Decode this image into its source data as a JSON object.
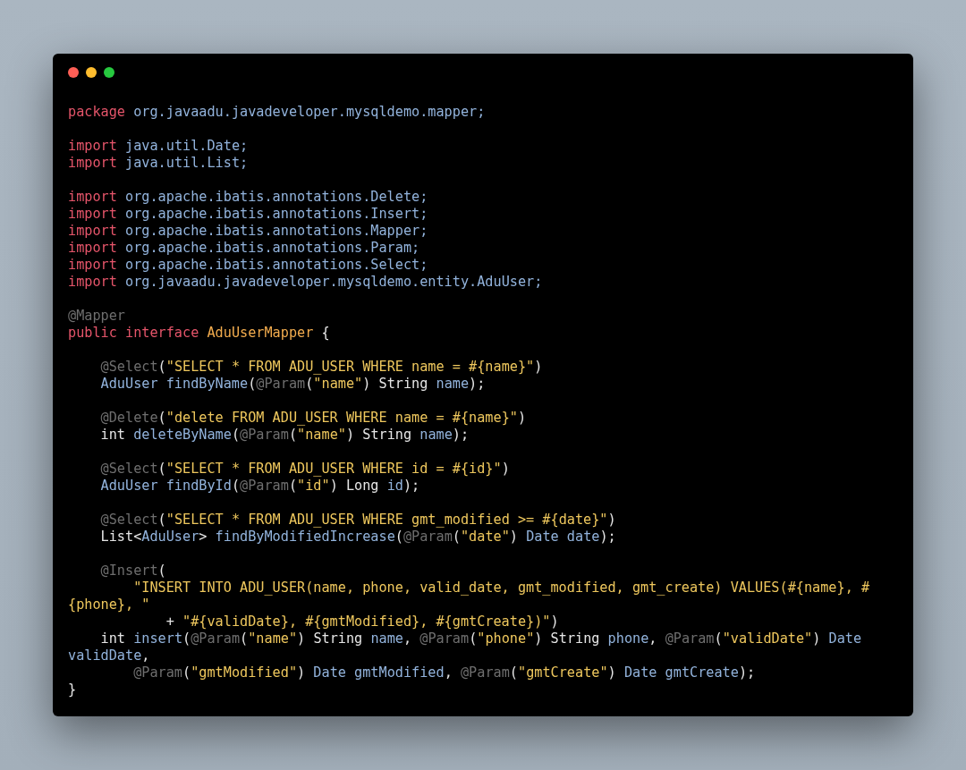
{
  "window": {
    "controls": [
      {
        "color": "#ff5f56"
      },
      {
        "color": "#ffbd2e"
      },
      {
        "color": "#27c93f"
      }
    ]
  },
  "code_lines": [
    {
      "kind": "code",
      "tokens": [
        {
          "kind": "keyword",
          "text": "package"
        },
        {
          "kind": "name",
          "text": " org.javaadu.javadeveloper.mysqldemo.mapper;"
        }
      ]
    },
    {
      "kind": "blank"
    },
    {
      "kind": "code",
      "tokens": [
        {
          "kind": "keyword",
          "text": "import"
        },
        {
          "kind": "name",
          "text": " java.util.Date;"
        }
      ]
    },
    {
      "kind": "code",
      "tokens": [
        {
          "kind": "keyword",
          "text": "import"
        },
        {
          "kind": "name",
          "text": " java.util.List;"
        }
      ]
    },
    {
      "kind": "blank"
    },
    {
      "kind": "code",
      "tokens": [
        {
          "kind": "keyword",
          "text": "import"
        },
        {
          "kind": "name",
          "text": " org.apache.ibatis.annotations.Delete;"
        }
      ]
    },
    {
      "kind": "code",
      "tokens": [
        {
          "kind": "keyword",
          "text": "import"
        },
        {
          "kind": "name",
          "text": " org.apache.ibatis.annotations.Insert;"
        }
      ]
    },
    {
      "kind": "code",
      "tokens": [
        {
          "kind": "keyword",
          "text": "import"
        },
        {
          "kind": "name",
          "text": " org.apache.ibatis.annotations.Mapper;"
        }
      ]
    },
    {
      "kind": "code",
      "tokens": [
        {
          "kind": "keyword",
          "text": "import"
        },
        {
          "kind": "name",
          "text": " org.apache.ibatis.annotations.Param;"
        }
      ]
    },
    {
      "kind": "code",
      "tokens": [
        {
          "kind": "keyword",
          "text": "import"
        },
        {
          "kind": "name",
          "text": " org.apache.ibatis.annotations.Select;"
        }
      ]
    },
    {
      "kind": "code",
      "tokens": [
        {
          "kind": "keyword",
          "text": "import"
        },
        {
          "kind": "name",
          "text": " org.javaadu.javadeveloper.mysqldemo.entity.AduUser;"
        }
      ]
    },
    {
      "kind": "blank"
    },
    {
      "kind": "code",
      "tokens": [
        {
          "kind": "annotation",
          "text": "@Mapper"
        }
      ]
    },
    {
      "kind": "code",
      "tokens": [
        {
          "kind": "keyword",
          "text": "public interface"
        },
        {
          "kind": "class",
          "text": " AduUserMapper"
        },
        {
          "kind": "plain",
          "text": " {"
        }
      ]
    },
    {
      "kind": "blank"
    },
    {
      "kind": "code",
      "tokens": [
        {
          "kind": "annotation",
          "text": "    @Select"
        },
        {
          "kind": "plain",
          "text": "("
        },
        {
          "kind": "string",
          "text": "\"SELECT * FROM ADU_USER WHERE name = #{name}\""
        },
        {
          "kind": "plain",
          "text": ")"
        }
      ]
    },
    {
      "kind": "code",
      "tokens": [
        {
          "kind": "name",
          "text": "    AduUser findByName"
        },
        {
          "kind": "plain",
          "text": "("
        },
        {
          "kind": "annotation",
          "text": "@Param"
        },
        {
          "kind": "plain",
          "text": "("
        },
        {
          "kind": "string",
          "text": "\"name\""
        },
        {
          "kind": "plain",
          "text": ") String"
        },
        {
          "kind": "name",
          "text": " name"
        },
        {
          "kind": "plain",
          "text": ");"
        }
      ]
    },
    {
      "kind": "blank"
    },
    {
      "kind": "code",
      "tokens": [
        {
          "kind": "annotation",
          "text": "    @Delete"
        },
        {
          "kind": "plain",
          "text": "("
        },
        {
          "kind": "string",
          "text": "\"delete FROM ADU_USER WHERE name = #{name}\""
        },
        {
          "kind": "plain",
          "text": ")"
        }
      ]
    },
    {
      "kind": "code",
      "tokens": [
        {
          "kind": "plain",
          "text": "    int"
        },
        {
          "kind": "name",
          "text": " deleteByName"
        },
        {
          "kind": "plain",
          "text": "("
        },
        {
          "kind": "annotation",
          "text": "@Param"
        },
        {
          "kind": "plain",
          "text": "("
        },
        {
          "kind": "string",
          "text": "\"name\""
        },
        {
          "kind": "plain",
          "text": ") String"
        },
        {
          "kind": "name",
          "text": " name"
        },
        {
          "kind": "plain",
          "text": ");"
        }
      ]
    },
    {
      "kind": "blank"
    },
    {
      "kind": "code",
      "tokens": [
        {
          "kind": "annotation",
          "text": "    @Select"
        },
        {
          "kind": "plain",
          "text": "("
        },
        {
          "kind": "string",
          "text": "\"SELECT * FROM ADU_USER WHERE id = #{id}\""
        },
        {
          "kind": "plain",
          "text": ")"
        }
      ]
    },
    {
      "kind": "code",
      "tokens": [
        {
          "kind": "name",
          "text": "    AduUser findById"
        },
        {
          "kind": "plain",
          "text": "("
        },
        {
          "kind": "annotation",
          "text": "@Param"
        },
        {
          "kind": "plain",
          "text": "("
        },
        {
          "kind": "string",
          "text": "\"id\""
        },
        {
          "kind": "plain",
          "text": ") Long"
        },
        {
          "kind": "name",
          "text": " id"
        },
        {
          "kind": "plain",
          "text": ");"
        }
      ]
    },
    {
      "kind": "blank"
    },
    {
      "kind": "code",
      "tokens": [
        {
          "kind": "annotation",
          "text": "    @Select"
        },
        {
          "kind": "plain",
          "text": "("
        },
        {
          "kind": "string",
          "text": "\"SELECT * FROM ADU_USER WHERE gmt_modified >= #{date}\""
        },
        {
          "kind": "plain",
          "text": ")"
        }
      ]
    },
    {
      "kind": "code",
      "tokens": [
        {
          "kind": "plain",
          "text": "    List<"
        },
        {
          "kind": "name",
          "text": "AduUser"
        },
        {
          "kind": "plain",
          "text": ">"
        },
        {
          "kind": "name",
          "text": " findByModifiedIncrease"
        },
        {
          "kind": "plain",
          "text": "("
        },
        {
          "kind": "annotation",
          "text": "@Param"
        },
        {
          "kind": "plain",
          "text": "("
        },
        {
          "kind": "string",
          "text": "\"date\""
        },
        {
          "kind": "plain",
          "text": ")"
        },
        {
          "kind": "name",
          "text": " Date date"
        },
        {
          "kind": "plain",
          "text": ");"
        }
      ]
    },
    {
      "kind": "blank"
    },
    {
      "kind": "code",
      "tokens": [
        {
          "kind": "annotation",
          "text": "    @Insert"
        },
        {
          "kind": "plain",
          "text": "("
        }
      ]
    },
    {
      "kind": "code",
      "tokens": [
        {
          "kind": "string",
          "text": "        \"INSERT INTO ADU_USER(name, phone, valid_date, gmt_modified, gmt_create) VALUES(#{name}, #"
        }
      ]
    },
    {
      "kind": "code",
      "tokens": [
        {
          "kind": "string",
          "text": "{phone}, \""
        }
      ]
    },
    {
      "kind": "code",
      "tokens": [
        {
          "kind": "plain",
          "text": "            + "
        },
        {
          "kind": "string",
          "text": "\"#{validDate}, #{gmtModified}, #{gmtCreate})\""
        },
        {
          "kind": "plain",
          "text": ")"
        }
      ]
    },
    {
      "kind": "code",
      "tokens": [
        {
          "kind": "plain",
          "text": "    int"
        },
        {
          "kind": "name",
          "text": " insert"
        },
        {
          "kind": "plain",
          "text": "("
        },
        {
          "kind": "annotation",
          "text": "@Param"
        },
        {
          "kind": "plain",
          "text": "("
        },
        {
          "kind": "string",
          "text": "\"name\""
        },
        {
          "kind": "plain",
          "text": ") String"
        },
        {
          "kind": "name",
          "text": " name"
        },
        {
          "kind": "plain",
          "text": ", "
        },
        {
          "kind": "annotation",
          "text": "@Param"
        },
        {
          "kind": "plain",
          "text": "("
        },
        {
          "kind": "string",
          "text": "\"phone\""
        },
        {
          "kind": "plain",
          "text": ") String"
        },
        {
          "kind": "name",
          "text": " phone"
        },
        {
          "kind": "plain",
          "text": ", "
        },
        {
          "kind": "annotation",
          "text": "@Param"
        },
        {
          "kind": "plain",
          "text": "("
        },
        {
          "kind": "string",
          "text": "\"validDate\""
        },
        {
          "kind": "plain",
          "text": ")"
        },
        {
          "kind": "name",
          "text": " Date"
        }
      ]
    },
    {
      "kind": "code",
      "tokens": [
        {
          "kind": "name",
          "text": "validDate"
        },
        {
          "kind": "plain",
          "text": ","
        }
      ]
    },
    {
      "kind": "code",
      "tokens": [
        {
          "kind": "annotation",
          "text": "        @Param"
        },
        {
          "kind": "plain",
          "text": "("
        },
        {
          "kind": "string",
          "text": "\"gmtModified\""
        },
        {
          "kind": "plain",
          "text": ")"
        },
        {
          "kind": "name",
          "text": " Date gmtModified"
        },
        {
          "kind": "plain",
          "text": ", "
        },
        {
          "kind": "annotation",
          "text": "@Param"
        },
        {
          "kind": "plain",
          "text": "("
        },
        {
          "kind": "string",
          "text": "\"gmtCreate\""
        },
        {
          "kind": "plain",
          "text": ")"
        },
        {
          "kind": "name",
          "text": " Date gmtCreate"
        },
        {
          "kind": "plain",
          "text": ");"
        }
      ]
    },
    {
      "kind": "code",
      "tokens": [
        {
          "kind": "plain",
          "text": "}"
        }
      ]
    }
  ]
}
